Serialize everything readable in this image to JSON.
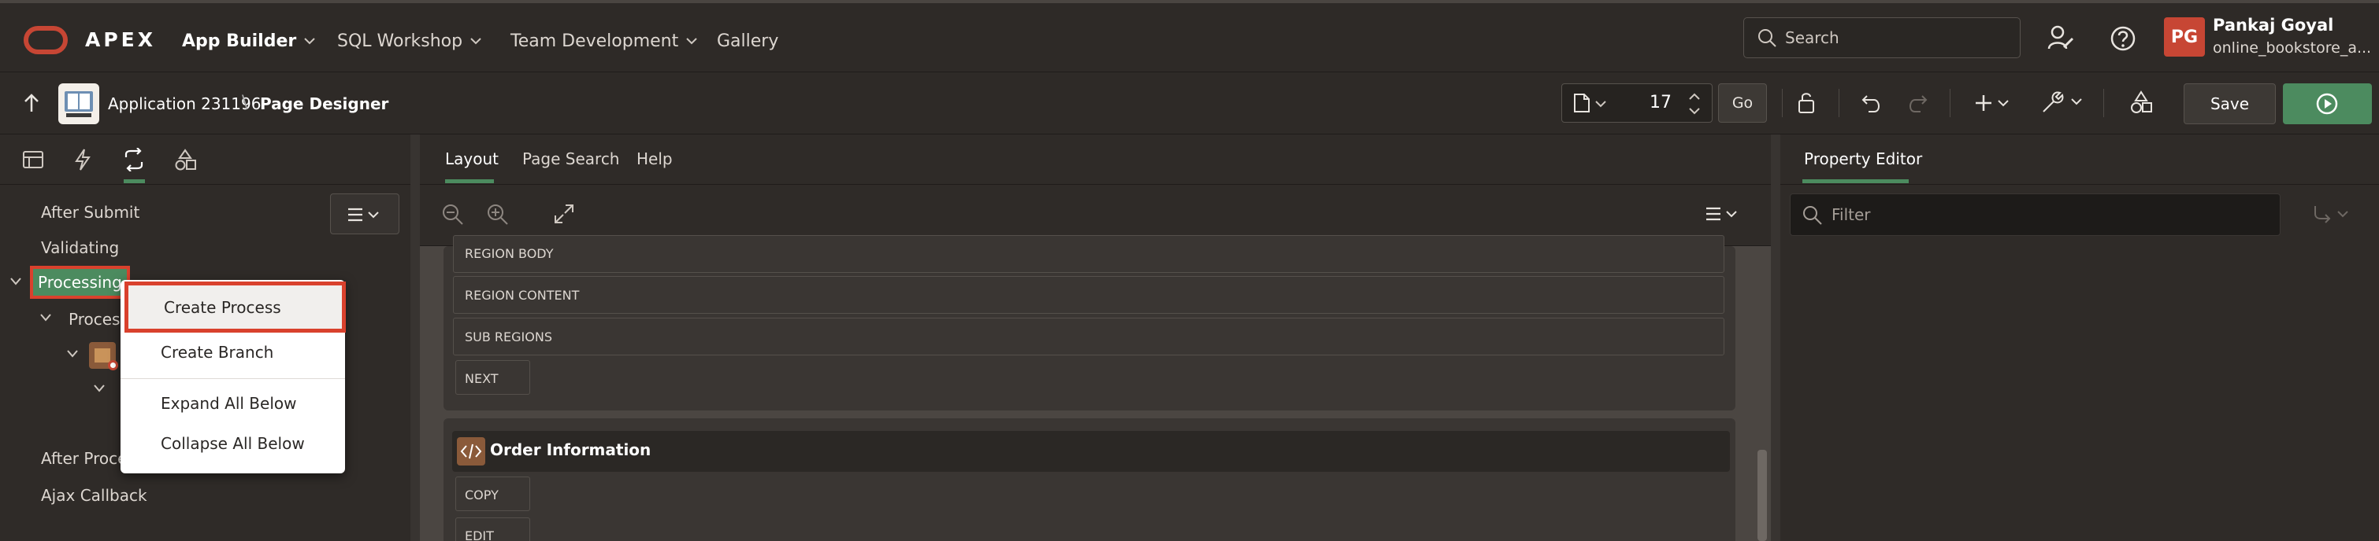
{
  "topbar": {
    "brand": "APEX",
    "menus": [
      {
        "label": "App Builder"
      },
      {
        "label": "SQL Workshop"
      },
      {
        "label": "Team Development"
      },
      {
        "label": "Gallery"
      }
    ],
    "search_placeholder": "Search",
    "user": {
      "initials": "PG",
      "name": "Pankaj Goyal",
      "app": "online_bookstore_a..."
    }
  },
  "toolbar": {
    "application_label": "Application 231196",
    "crumb_separator": "\\",
    "page_designer_label": "Page Designer",
    "page_number": "17",
    "go_label": "Go",
    "save_label": "Save"
  },
  "left_panel": {
    "tree": {
      "after_submit": "After Submit",
      "validating": "Validating",
      "processing": "Processing",
      "processes": "Process",
      "after_processing": "After Proces",
      "ajax_callback": "Ajax Callback"
    },
    "context_menu": {
      "create_process": "Create Process",
      "create_branch": "Create Branch",
      "expand_all": "Expand All Below",
      "collapse_all": "Collapse All Below"
    }
  },
  "center": {
    "tabs": [
      "Layout",
      "Page Search",
      "Help"
    ],
    "positions": [
      "REGION BODY",
      "REGION CONTENT",
      "SUB REGIONS",
      "NEXT",
      "COPY",
      "EDIT"
    ],
    "region_title": "Order Information"
  },
  "right_panel": {
    "title": "Property Editor",
    "filter_placeholder": "Filter"
  },
  "colors": {
    "accent_green": "#4c8b5f",
    "highlight_red": "#d9412d",
    "avatar_red": "#c74634"
  }
}
